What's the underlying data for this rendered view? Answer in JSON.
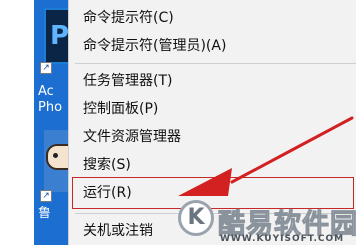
{
  "desktop": {
    "icons": [
      {
        "name": "photoshop",
        "label": "Ac\nPho",
        "tile_letter": "P",
        "shortcut_glyph": "↗"
      },
      {
        "name": "cartoon-app",
        "label": "鲁",
        "shortcut_glyph": "↗"
      }
    ]
  },
  "context_menu": {
    "items": [
      {
        "label": "命令提示符(C)"
      },
      {
        "label": "命令提示符(管理员)(A)"
      },
      {
        "label": "任务管理器(T)"
      },
      {
        "label": "控制面板(P)"
      },
      {
        "label": "文件资源管理器"
      },
      {
        "label": "搜索(S)"
      },
      {
        "label": "运行(R)"
      },
      {
        "label": "关机或注销"
      }
    ],
    "highlighted_item": "运行(R)",
    "highlight_color": "#c62828"
  },
  "watermark": {
    "logo_letter": "K",
    "text": "酷易软件园",
    "url": "WWW.KUYISOFT.COM"
  }
}
